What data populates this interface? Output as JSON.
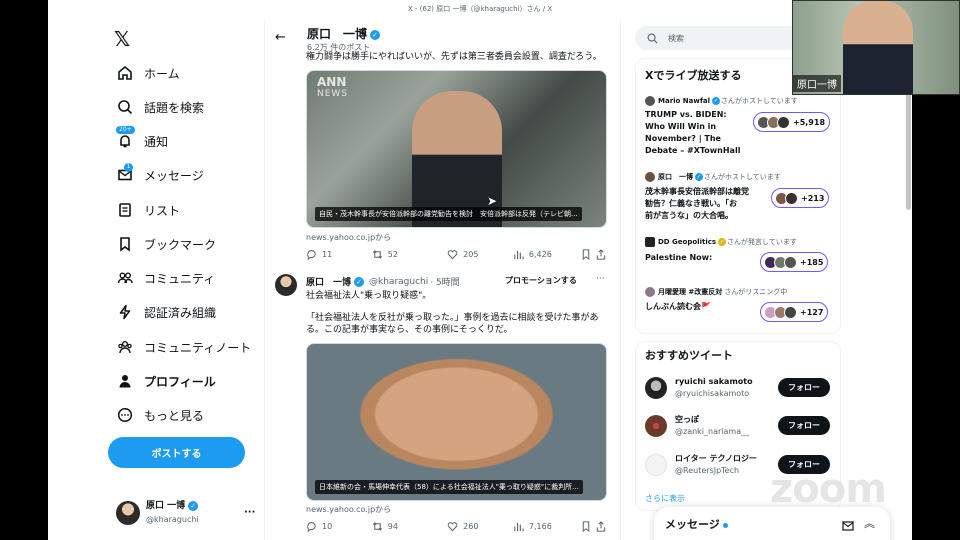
{
  "window_title": "X - (62) 原口 一博（@kharaguchi）さん / X",
  "nav": {
    "items": [
      {
        "label": "ホーム",
        "icon": "home-icon"
      },
      {
        "label": "話題を検索",
        "icon": "search-icon"
      },
      {
        "label": "通知",
        "icon": "bell-icon",
        "badge": "20+"
      },
      {
        "label": "メッセージ",
        "icon": "mail-icon",
        "badge": "1"
      },
      {
        "label": "リスト",
        "icon": "list-icon"
      },
      {
        "label": "ブックマーク",
        "icon": "bookmark-icon"
      },
      {
        "label": "コミュニティ",
        "icon": "community-icon"
      },
      {
        "label": "認証済み組織",
        "icon": "lightning-icon"
      },
      {
        "label": "コミュニティノート",
        "icon": "notes-icon"
      },
      {
        "label": "プロフィール",
        "icon": "person-icon"
      },
      {
        "label": "もっと見る",
        "icon": "more-circle-icon"
      }
    ],
    "post_button": "ポストする"
  },
  "account": {
    "name": "原口 一博",
    "handle": "@kharaguchi"
  },
  "profile_header": {
    "name": "原口　一博",
    "post_count": "6.2万 件のポスト"
  },
  "tweet1": {
    "text_tail": "権力闘争は勝手にやればいいが、先ずは第三者委員会設置、調査だろう。",
    "image_logo": "ANN",
    "image_logo_sub": "NEWS",
    "image_caption": "自民・茂木幹事長が安倍派幹部の離党勧告を検討　安倍派幹部は反発（テレビ朝...",
    "domain": "news.yahoo.co.jpから",
    "replies": "11",
    "reposts": "52",
    "likes": "205",
    "views": "6,426"
  },
  "tweet2": {
    "name": "原口　一博",
    "handle": "@kharaguchi",
    "time": "· 5時間",
    "promo": "プロモーションする",
    "line1": "社会福祉法人\"乗っ取り疑惑\"。",
    "line2": "「社会福祉法人を反社が乗っ取った。」事例を過去に相談を受けた事があ",
    "line3": "る。この記事が事実なら、その事例にそっくりだ。",
    "image_caption": "日本維新の会・馬場伸幸代表（58）による社会福祉法人\"乗っ取り疑惑\"に裁判所...",
    "domain": "news.yahoo.co.jpから",
    "replies": "10",
    "reposts": "94",
    "likes": "260",
    "views": "7,166"
  },
  "search": {
    "placeholder": "検索"
  },
  "spaces": {
    "title": "Xでライブ放送する",
    "items": [
      {
        "host": "Mario Nawfal",
        "status": "さんがホストしています",
        "title_lines": [
          "TRUMP vs. BIDEN:",
          "Who Will Win in",
          "November? | The",
          "Debate – #XTownHall"
        ],
        "listeners": "+5,918"
      },
      {
        "host": "原口　一博",
        "status": "さんがホストしています",
        "title_lines": [
          "茂木幹事長安倍派幹部は離党",
          "勧告？仁義なき戦い。「お",
          "前が言うな」の大合唱。"
        ],
        "listeners": "+213"
      },
      {
        "host": "DD Geopolitics",
        "status": "さんが発言しています",
        "title_lines": [
          "Palestine Now:"
        ],
        "listeners": "+185"
      },
      {
        "host": "月曜愛理 #改憲反対",
        "status": "さんがリスニング中",
        "title_lines": [
          "しんぶん読む会🚩"
        ],
        "listeners": "+127"
      }
    ]
  },
  "recommend": {
    "title": "おすすめツイート",
    "items": [
      {
        "name": "ryuichi sakamoto",
        "handle": "@ryuichisakamoto",
        "button": "フォロー"
      },
      {
        "name": "空っぽ",
        "handle": "@zanki_nariama__",
        "button": "フォロー"
      },
      {
        "name": "ロイター テクノロジー",
        "handle": "@ReutersJpTech",
        "button": "フォロー"
      }
    ],
    "more": "さらに表示"
  },
  "messages_drawer": {
    "title": "メッセージ"
  },
  "zoom": {
    "participant_name": "原口一博",
    "watermark": "zoom"
  },
  "colors": {
    "accent": "#1d9bf0",
    "spaces_ring": "#7856ff",
    "text": "#0f1419",
    "muted": "#536471"
  }
}
